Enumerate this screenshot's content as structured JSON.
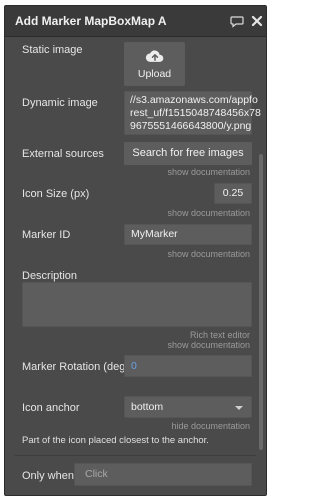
{
  "header": {
    "title": "Add Marker MapBoxMap A",
    "chat_icon": "chat-bubble-icon",
    "close_icon": "close-icon"
  },
  "fields": {
    "static_image": {
      "label": "Static image",
      "button_label": "Upload",
      "icon": "cloud-upload-icon"
    },
    "dynamic_image": {
      "label": "Dynamic image",
      "lines": [
        "//s3.amazonaws.com/appfo",
        "rest_uf/f1515048748456x78",
        "9675551466643800/y.png"
      ]
    },
    "external_sources": {
      "label": "External sources",
      "button_label": "Search for free images",
      "doc": "show documentation"
    },
    "icon_size": {
      "label": "Icon Size (px)",
      "value": "0.25",
      "doc": "show documentation"
    },
    "marker_id": {
      "label": "Marker ID",
      "value": "MyMarker",
      "doc": "show documentation"
    },
    "description": {
      "label": "Description",
      "value": "",
      "rich_text": "Rich text editor",
      "doc": "show documentation"
    },
    "marker_rotation": {
      "label": "Marker Rotation (deg)",
      "value": "0",
      "value_color": "#6aa0e8"
    },
    "icon_anchor": {
      "label": "Icon anchor",
      "value": "bottom",
      "doc": "hide documentation",
      "help": "Part of the icon placed closest to the anchor."
    },
    "only_when": {
      "label": "Only when",
      "placeholder": "Click"
    }
  }
}
